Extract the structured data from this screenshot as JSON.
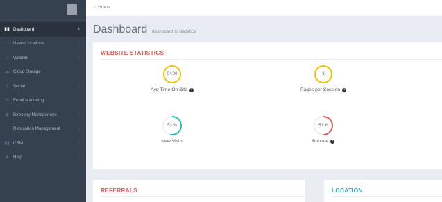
{
  "sidebar": {
    "items": [
      {
        "label": "Dashboard",
        "icon": "bar-chart-icon",
        "glyph": "▮▮",
        "active": true
      },
      {
        "label": "Users/Locations",
        "icon": "folder-icon",
        "glyph": "▭"
      },
      {
        "label": "Website",
        "icon": "folder-open-icon",
        "glyph": "▱"
      },
      {
        "label": "Cloud Storage",
        "icon": "cloud-icon",
        "glyph": "☁"
      },
      {
        "label": "Social",
        "icon": "thumbs-up-icon",
        "glyph": "♙"
      },
      {
        "label": "Email Marketing",
        "icon": "envelope-icon",
        "glyph": "✉"
      },
      {
        "label": "Directory Management",
        "icon": "map-pin-icon",
        "glyph": "◉"
      },
      {
        "label": "Reputation Management",
        "icon": "star-icon",
        "glyph": "☆"
      },
      {
        "label": "CRM",
        "icon": "chart-icon",
        "glyph": "▮▮"
      },
      {
        "label": "Help",
        "icon": "help-icon",
        "glyph": "●"
      }
    ]
  },
  "breadcrumb": {
    "home_label": "Home"
  },
  "page": {
    "title": "Dashboard",
    "subtitle": "dashboard & statistics"
  },
  "stats": {
    "title": "WEBSITE STATISTICS",
    "items": [
      {
        "value": "04:00",
        "label": "Avg Time On Site",
        "kind": "circle",
        "color": "#f3c200"
      },
      {
        "value": "3",
        "label": "Pages per Session",
        "kind": "circle",
        "color": "#f3c200"
      },
      {
        "value": "53 %",
        "label": "New Visits",
        "kind": "pie",
        "percent": 53,
        "color": "#26c2a3"
      },
      {
        "value": "51 %",
        "label": "Bounce",
        "kind": "pie",
        "percent": 51,
        "color": "#e35b5a"
      }
    ]
  },
  "referrals": {
    "title": "REFERRALS"
  },
  "location": {
    "title": "LOCATION"
  }
}
